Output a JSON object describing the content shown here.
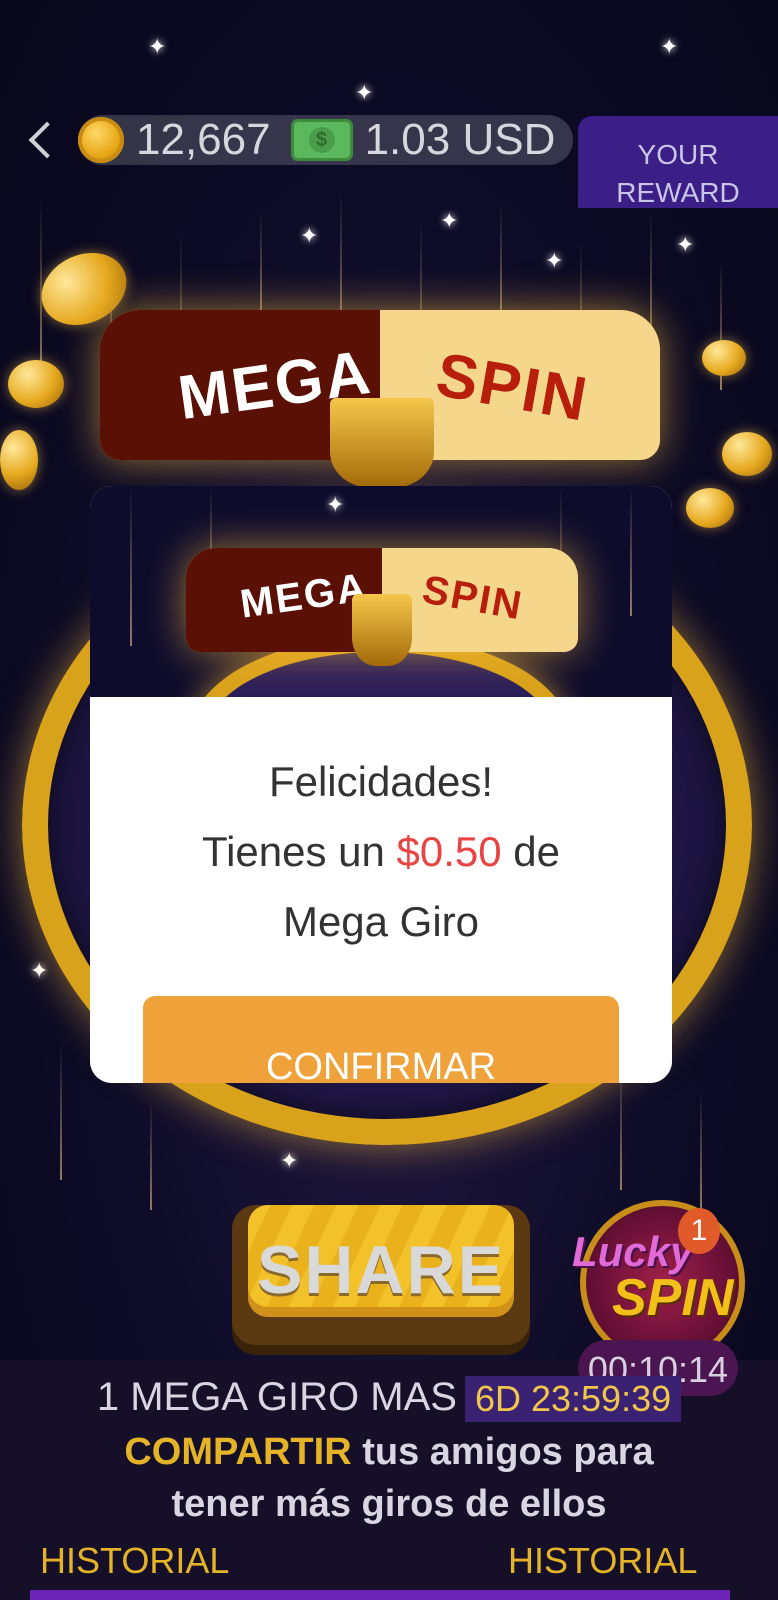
{
  "header": {
    "coins": "12,667",
    "cash": "1.03 USD",
    "reward_label": "YOUR REWARD"
  },
  "wheel": {
    "banner_left": "MEGA",
    "banner_right": "SPIN"
  },
  "modal": {
    "line1": "Felicidades!",
    "line2_prefix": "Tienes un ",
    "amount": "$0.50",
    "line2_suffix": " de",
    "line3": "Mega Giro",
    "confirm_label": "CONFIRMAR"
  },
  "share": {
    "label": "SHARE"
  },
  "lucky_spin": {
    "word1": "Lucky",
    "word2": "SPIN",
    "badge": "1",
    "timer": "00:10:14"
  },
  "info": {
    "prefix": "1 MEGA GIRO MAS",
    "countdown": "6D 23:59:39",
    "highlight": "COMPARTIR",
    "rest1": " tus amigos para",
    "rest2": "tener más giros de ellos"
  },
  "tabs": {
    "left": "HISTORIAL",
    "right": "HISTORIAL"
  },
  "colors": {
    "accent_gold": "#e5b327",
    "confirm": "#f0a23a",
    "amount_red": "#e84444",
    "reward_purple": "#3b1e86"
  }
}
